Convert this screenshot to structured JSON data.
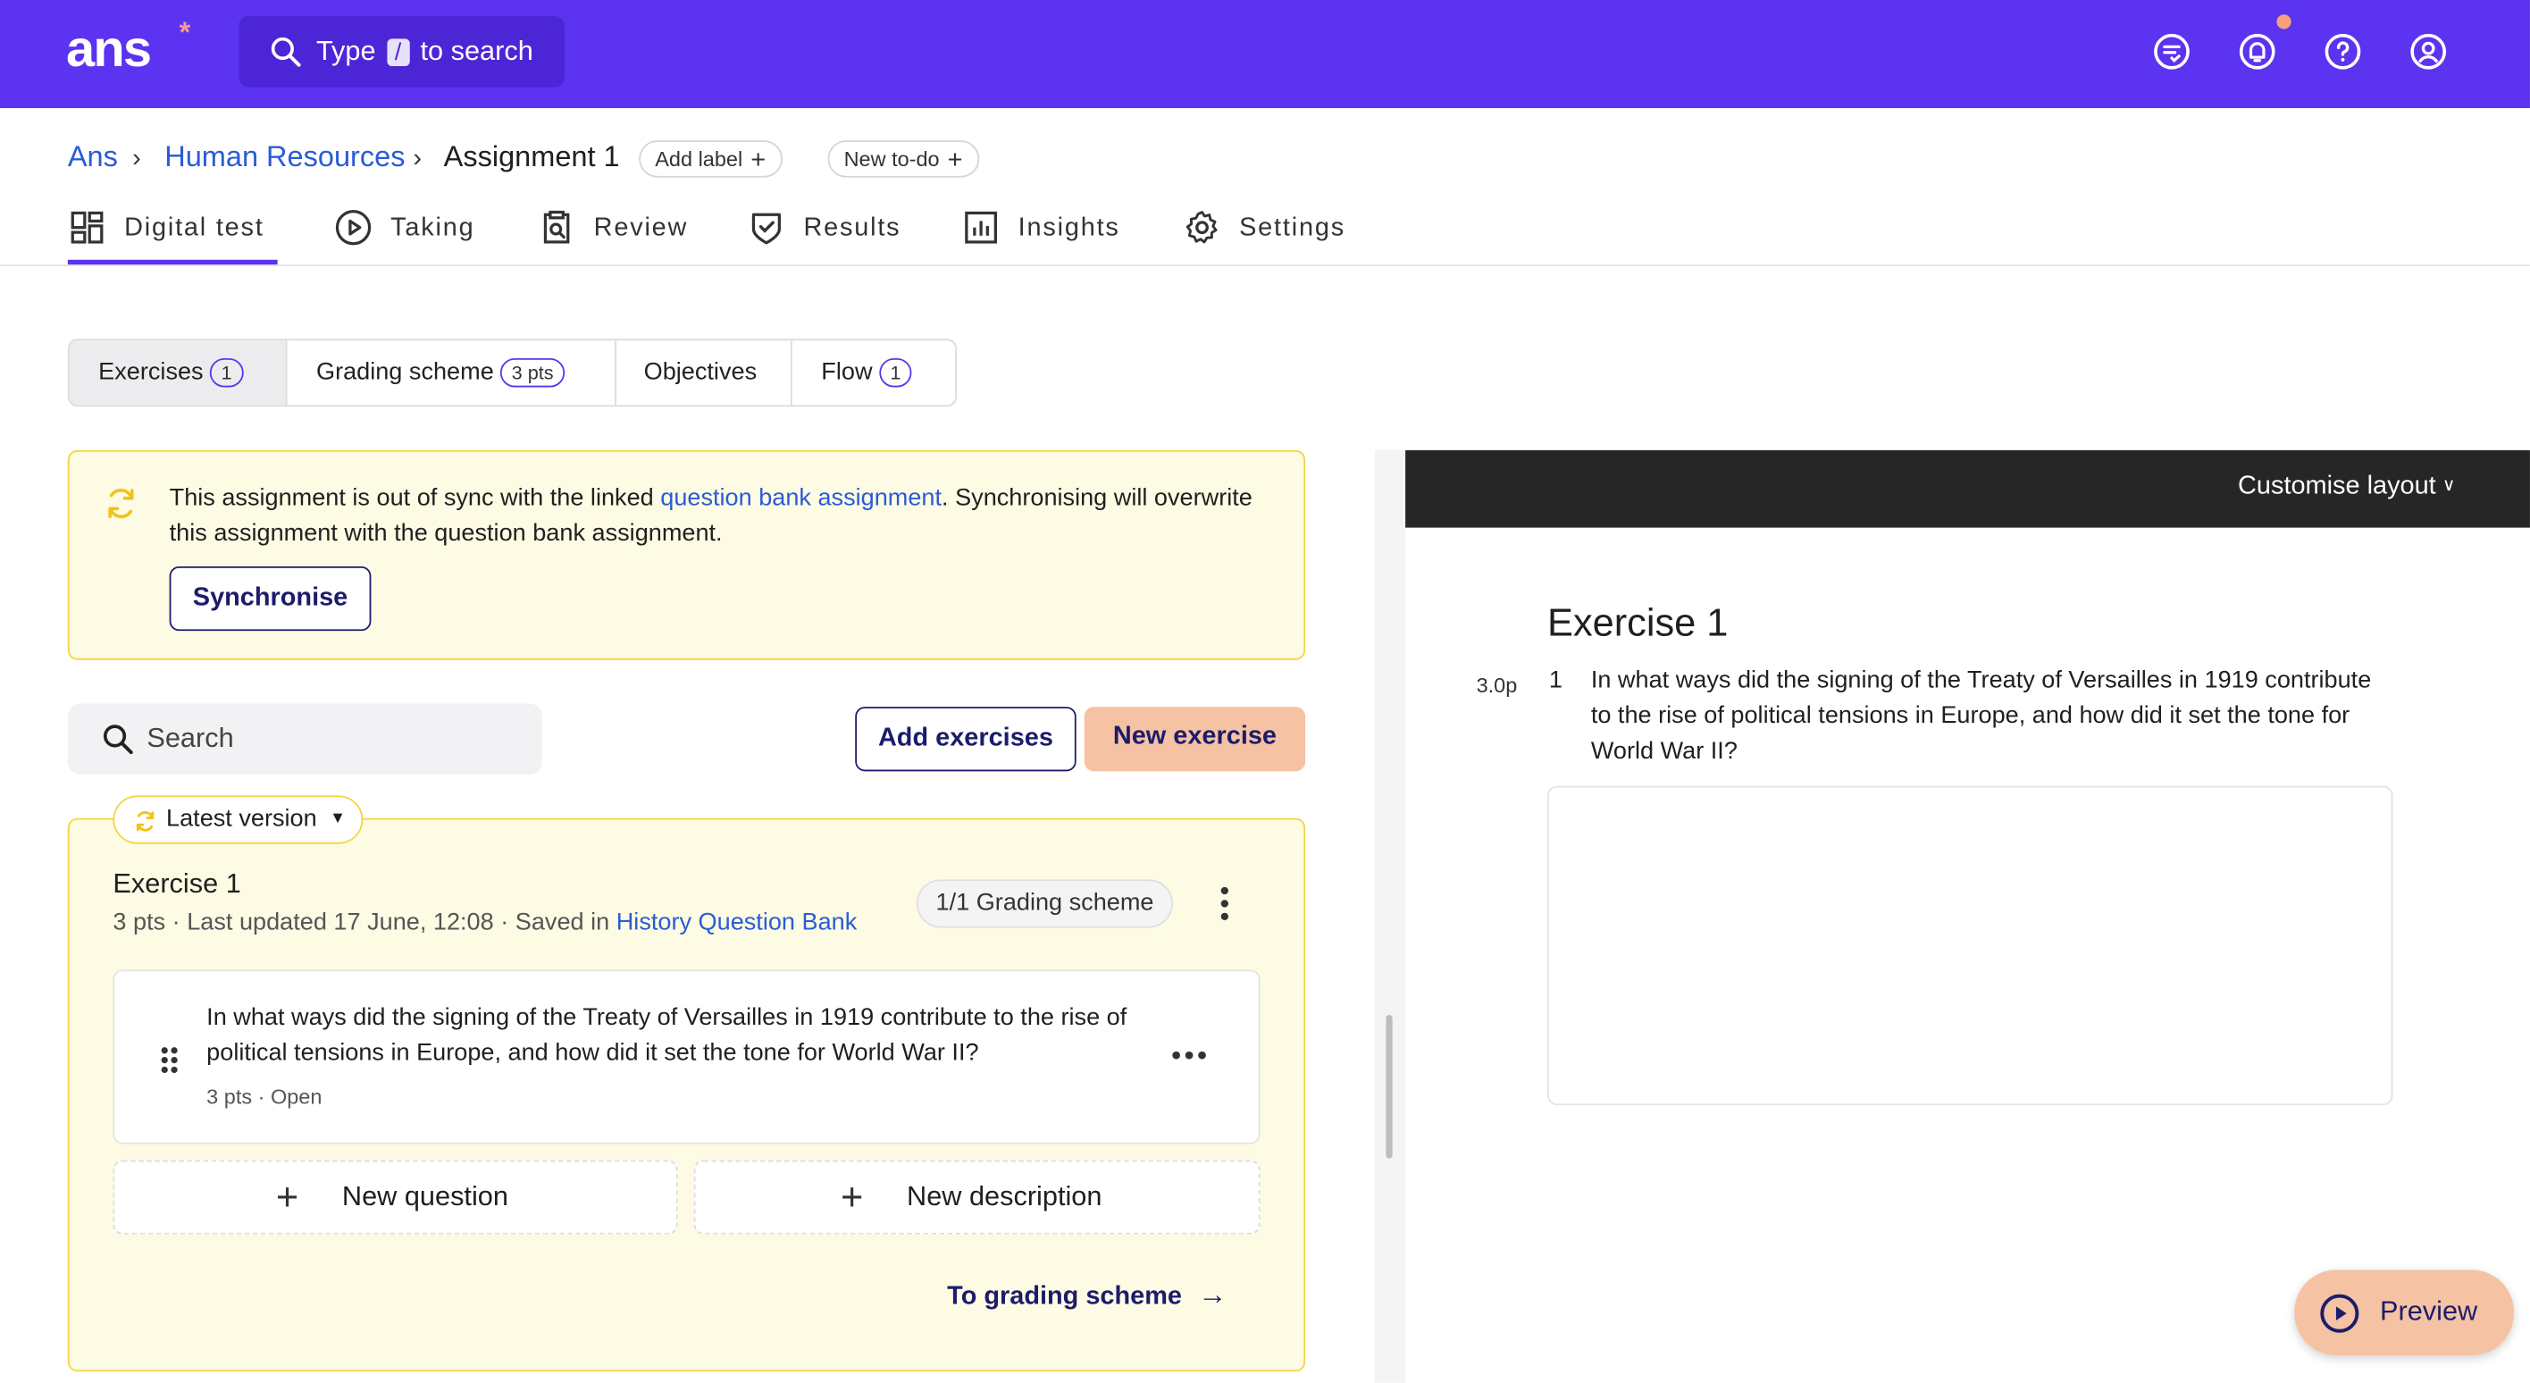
{
  "header": {
    "logo": "ans",
    "logo_mark": "*",
    "search": {
      "prefix": "Type",
      "key": "/",
      "suffix": "to search"
    },
    "icons": [
      "chat-icon",
      "bell-icon",
      "help-icon",
      "user-icon"
    ]
  },
  "breadcrumb": {
    "items": [
      "Ans",
      "Human Resources",
      "Assignment 1"
    ],
    "separator": "›",
    "add_label": "Add label",
    "new_todo": "New to-do"
  },
  "nav": {
    "tabs": [
      {
        "label": "Digital test",
        "icon": "dashboard-icon",
        "active": true
      },
      {
        "label": "Taking",
        "icon": "play-icon"
      },
      {
        "label": "Review",
        "icon": "clipboard-search-icon"
      },
      {
        "label": "Results",
        "icon": "shield-check-icon"
      },
      {
        "label": "Insights",
        "icon": "bar-chart-icon"
      },
      {
        "label": "Settings",
        "icon": "gear-icon"
      }
    ]
  },
  "subtabs": [
    {
      "label": "Exercises",
      "badge": "1",
      "active": true
    },
    {
      "label": "Grading scheme",
      "badge": "3 pts"
    },
    {
      "label": "Objectives",
      "badge": ""
    },
    {
      "label": "Flow",
      "badge": "1"
    }
  ],
  "notice": {
    "text_before": "This assignment is out of sync with the linked ",
    "link": "question bank assignment",
    "text_after": ". Synchronising will overwrite this assignment with the question bank assignment.",
    "button": "Synchronise"
  },
  "toolbar": {
    "search_placeholder": "Search",
    "add_exercises": "Add exercises",
    "new_exercise": "New exercise"
  },
  "exercise": {
    "version": "Latest version",
    "title": "Exercise 1",
    "meta_prefix": "3 pts · Last updated 17 June, 12:08 · Saved in ",
    "meta_link": "History Question Bank",
    "grading": "1/1 Grading scheme",
    "question": {
      "text": "In what ways did the signing of the Treaty of Versailles in 1919 contribute to the rise of political tensions in Europe, and how did it set the tone for World War II?",
      "meta": "3 pts · Open"
    },
    "new_question": "New question",
    "new_description": "New description",
    "to_grading": "To grading scheme"
  },
  "preview": {
    "customise": "Customise layout",
    "title": "Exercise 1",
    "points": "3.0p",
    "number": "1",
    "question": "In what ways did the signing of the Treaty of Versailles in 1919 contribute to the rise of political tensions in Europe, and how did it set the tone for World War II?",
    "button": "Preview"
  },
  "colors": {
    "brand": "#5b33f0",
    "notice_bg": "#fdfbe3",
    "notice_border": "#f2d640",
    "accent_button": "#f5c3a3",
    "navy": "#1c1c6b",
    "link": "#2a5bd7"
  }
}
